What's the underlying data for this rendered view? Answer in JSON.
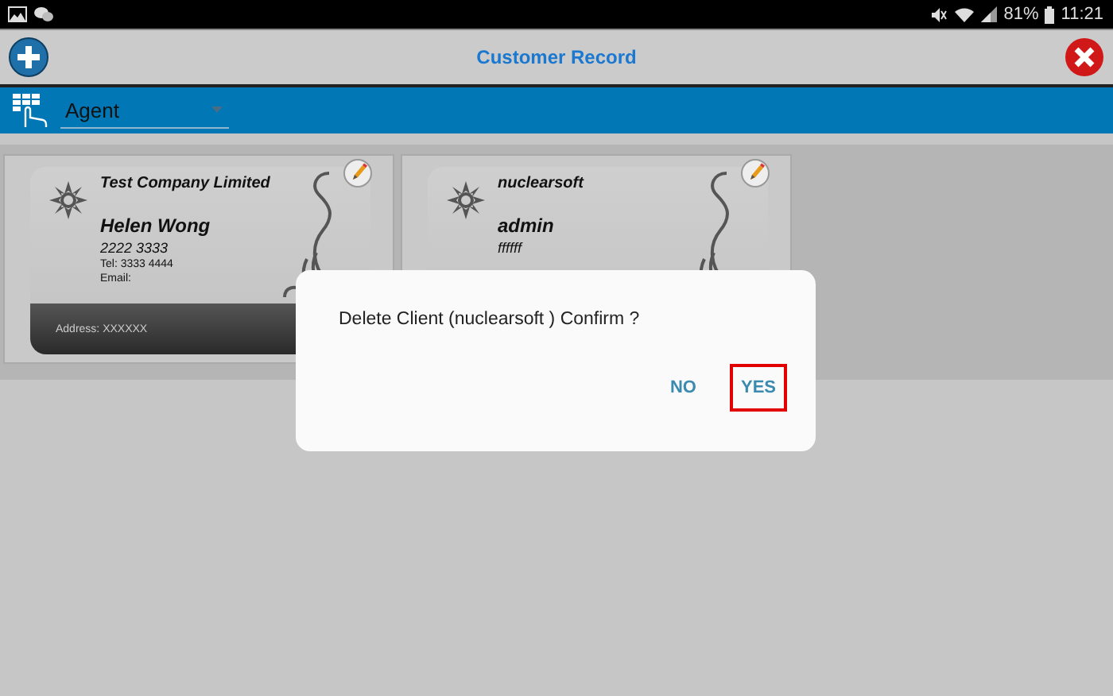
{
  "status_bar": {
    "battery": "81%",
    "time": "11:21"
  },
  "header": {
    "title": "Customer Record"
  },
  "filter": {
    "value": "Agent"
  },
  "cards": [
    {
      "company": "Test Company Limited",
      "name": "Helen Wong",
      "phone": "2222 3333",
      "tel": "Tel: 3333 4444",
      "email": "Email:",
      "address": "Address: XXXXXX"
    },
    {
      "company": "nuclearsoft",
      "name": "admin",
      "phone": "ffffff"
    }
  ],
  "dialog": {
    "message": "Delete Client (nuclearsoft ) Confirm ?",
    "buttons": [
      {
        "label": "NO",
        "highlighted": false
      },
      {
        "label": "YES",
        "highlighted": true
      }
    ]
  }
}
